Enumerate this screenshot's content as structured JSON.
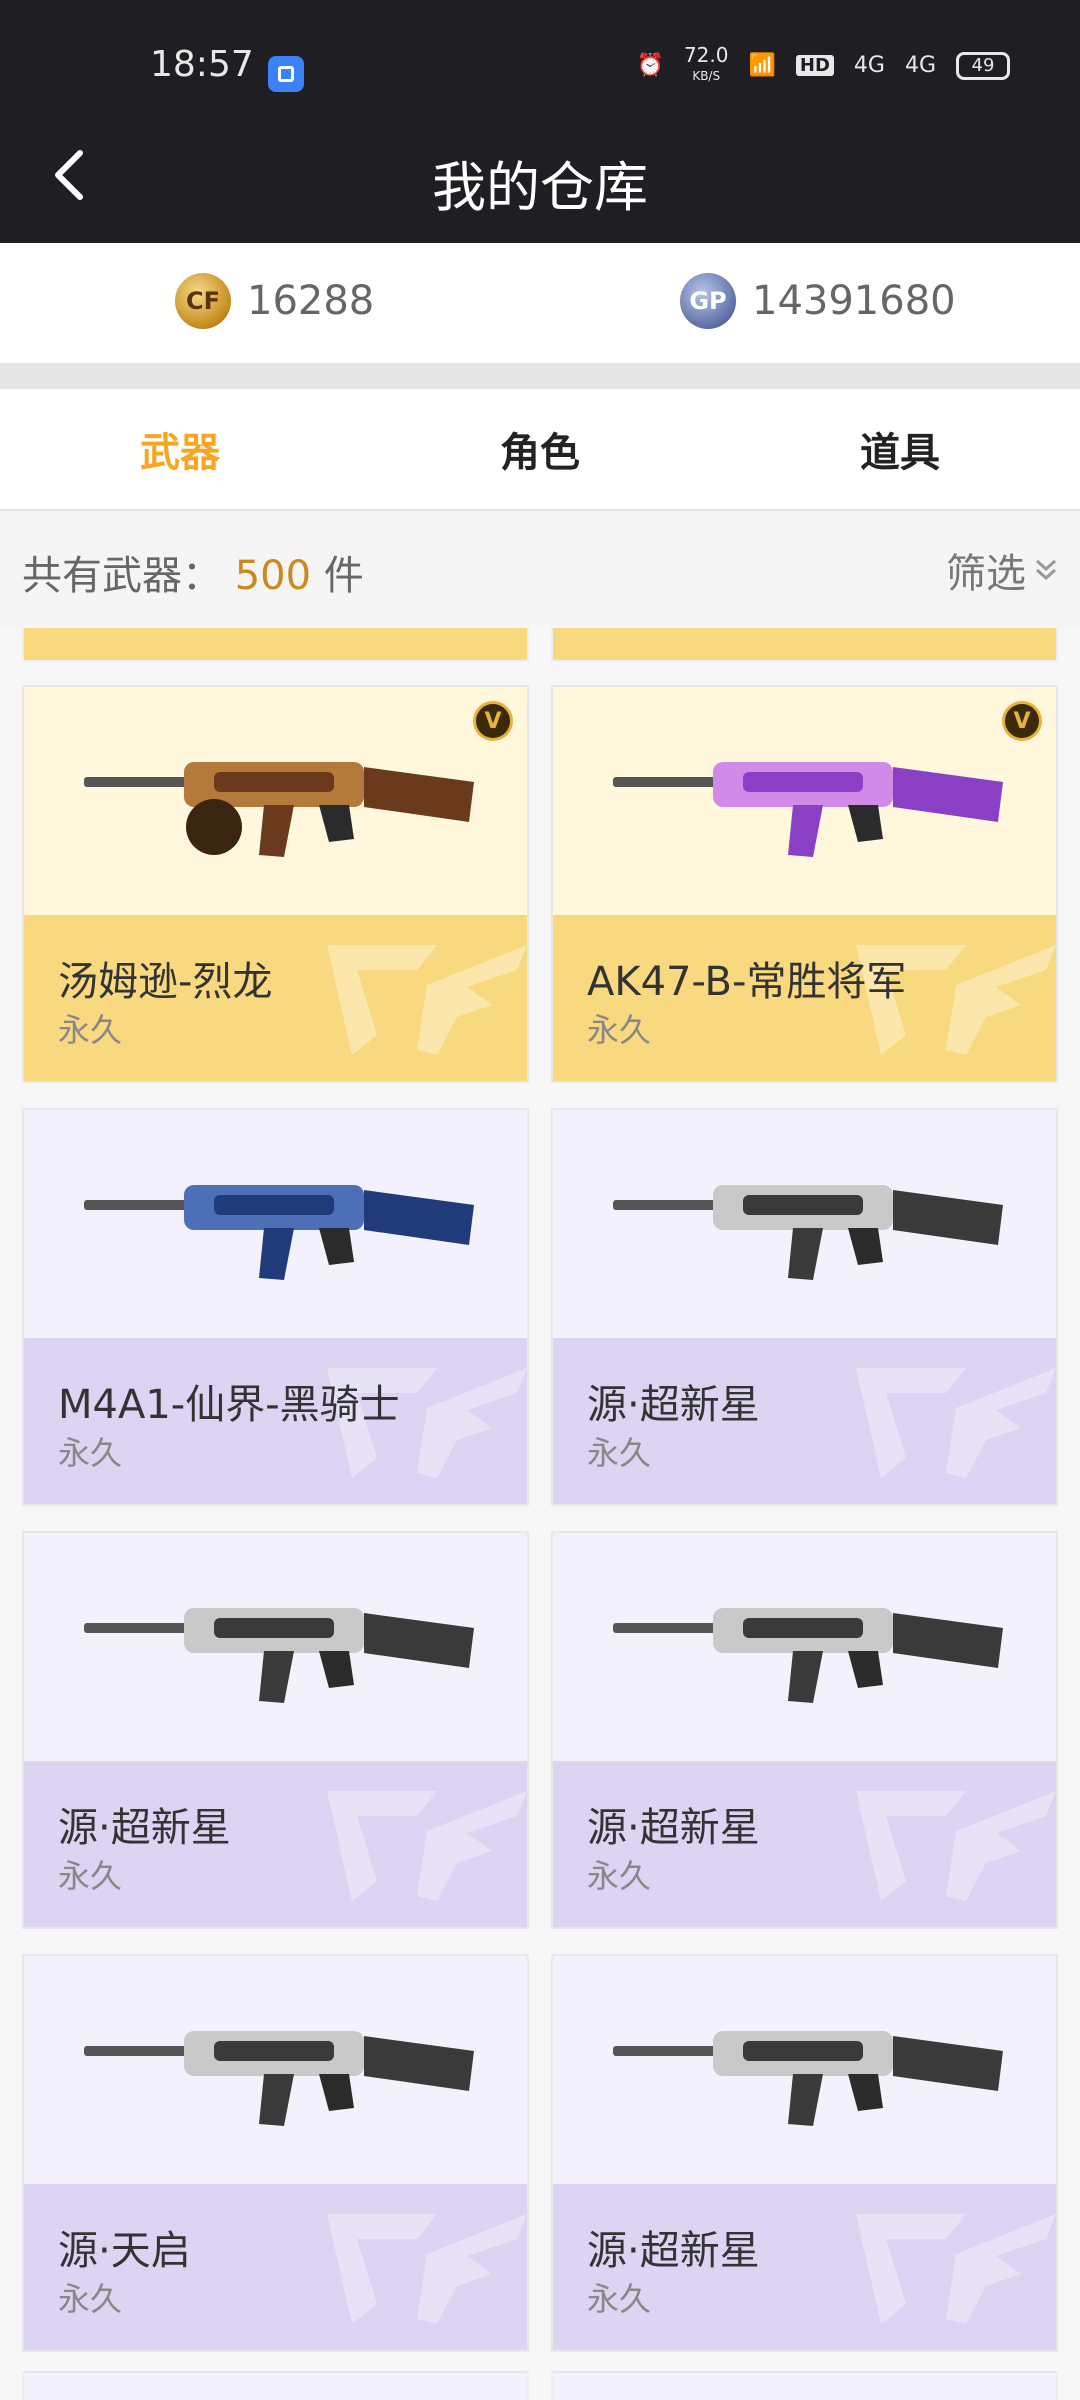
{
  "status_bar": {
    "time": "18:57",
    "net_speed": "72.0",
    "net_unit": "KB/S",
    "hd": "HD",
    "sig1": "4G",
    "sig2": "4G",
    "battery": "49"
  },
  "header": {
    "title": "我的仓库"
  },
  "currency": {
    "cf_coins": "16288",
    "gp": "14391680",
    "cf_coin_icon": "CF",
    "gp_icon": "GP"
  },
  "tabs": [
    {
      "label": "武器",
      "active": true
    },
    {
      "label": "角色",
      "active": false
    },
    {
      "label": "道具",
      "active": false
    }
  ],
  "count": {
    "prefix": "共有武器：",
    "number": "500",
    "suffix": "件"
  },
  "filter": {
    "label": "筛选"
  },
  "items": [
    {
      "name": "汤姆逊-烈龙",
      "duration": "永久",
      "tier": "gold",
      "vip": true,
      "badge": "V"
    },
    {
      "name": "AK47-B-常胜将军",
      "duration": "永久",
      "tier": "gold",
      "vip": true,
      "badge": "V"
    },
    {
      "name": "M4A1-仙界-黑骑士",
      "duration": "永久",
      "tier": "purple",
      "vip": false
    },
    {
      "name": "源·超新星",
      "duration": "永久",
      "tier": "purple",
      "vip": false
    },
    {
      "name": "源·超新星",
      "duration": "永久",
      "tier": "purple",
      "vip": false
    },
    {
      "name": "源·超新星",
      "duration": "永久",
      "tier": "purple",
      "vip": false
    },
    {
      "name": "源·天启",
      "duration": "永久",
      "tier": "purple",
      "vip": false
    },
    {
      "name": "源·超新星",
      "duration": "永久",
      "tier": "purple",
      "vip": false
    }
  ],
  "colors": {
    "accent": "#f5a623",
    "header_bg": "#1f1f23",
    "gold_label": "#f9d97f",
    "purple_label": "#ddd3f2"
  }
}
